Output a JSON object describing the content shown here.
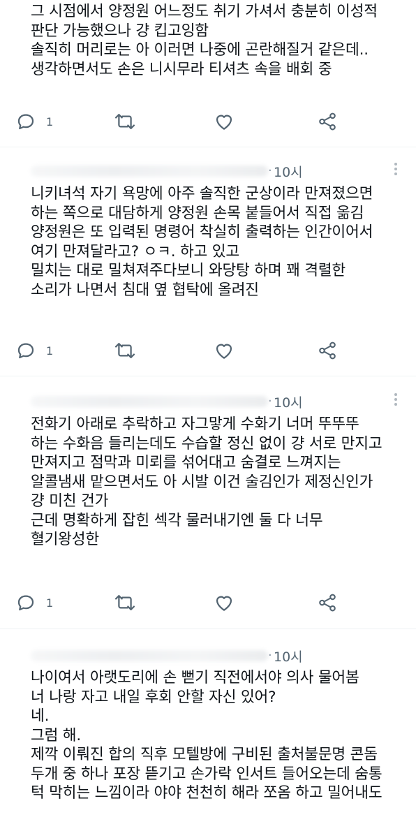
{
  "tweets": [
    {
      "time": "",
      "lines": [
        "그 시점에서 양정원 어느정도 취기 가셔서 충분히 이성적",
        "판단 가능했으나 걍 킵고잉함",
        "솔직히 머리로는 아 이러면 나중에 곤란해질거 같은데..",
        "생각하면서도 손은 니시무라 티셔츠 속을 배회 중"
      ],
      "reply_count": "1"
    },
    {
      "time": "10시",
      "lines": [
        "니키녀석 자기 욕망에 아주 솔직한 군상이라 만져졌으면",
        "하는 쪽으로 대담하게 양정원 손목 붙들어서 직접 옮김",
        "양정원은 또 입력된 명령어 착실히 출력하는 인간이어서",
        "여기 만져달라고? ㅇㅋ. 하고 있고",
        "밀치는 대로 밀쳐져주다보니 와당탕 하며 꽤 격렬한",
        "소리가 나면서 침대 옆 협탁에 올려진"
      ],
      "reply_count": "1"
    },
    {
      "time": "10시",
      "lines": [
        "전화기 아래로 추락하고 자그맣게 수화기 너머 뚜뚜뚜",
        "하는 수화음 들리는데도 수습할 정신 없이 걍 서로 만지고",
        "만져지고 점막과 미뢰를 섞어대고 숨결로 느껴지는",
        "알콜냄새 맡으면서도 아 시발 이건 술김인가 제정신인가",
        "걍 미친 건가",
        "근데 명확하게 잡힌 섹각 물러내기엔 둘 다 너무",
        "혈기왕성한"
      ],
      "reply_count": "1"
    },
    {
      "time": "10시",
      "lines": [
        "나이여서 아랫도리에 손 뻗기 직전에서야 의사 물어봄",
        "너 나랑 자고 내일 후회 안할 자신 있어?",
        "네.",
        "그럼 해.",
        "제깍 이뤄진 합의 직후 모텔방에 구비된 출처불문명 콘돔",
        "두개 중 하나 포장 뜯기고 손가락 인서트 들어오는데 숨통",
        "턱 막히는 느낌이라 야야 천천히 해라 쪼옴 하고 밀어내도"
      ],
      "reply_count": ""
    }
  ],
  "icons": {
    "reply": "reply-bubble-icon",
    "retweet": "retweet-icon",
    "like": "heart-icon",
    "share": "share-icon",
    "more": "more-dots-icon"
  },
  "colors": {
    "text": "#0f1419",
    "muted": "#536471",
    "icon": "#536471",
    "divider": "#eff3f4"
  }
}
